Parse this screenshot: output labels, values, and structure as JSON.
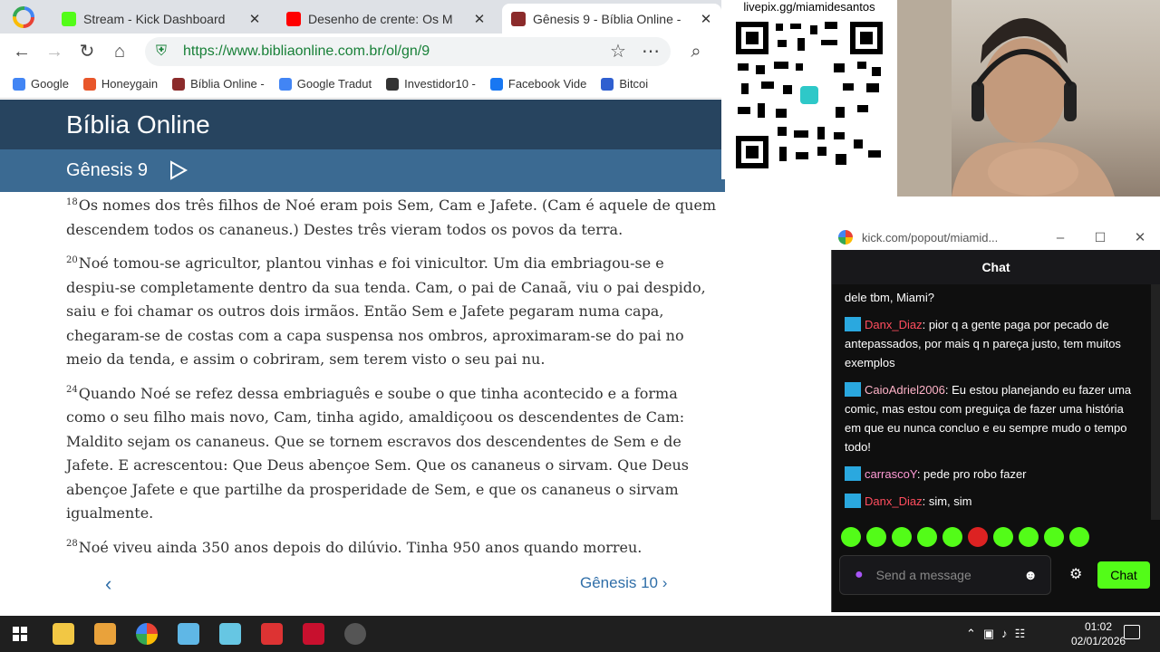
{
  "browser": {
    "tabs": [
      {
        "title": "Stream - Kick Dashboard",
        "color": "#53fc18",
        "active": false
      },
      {
        "title": "Desenho de crente: Os M",
        "color": "#ff0000",
        "active": false
      },
      {
        "title": "Gênesis 9 - Bíblia Online -",
        "color": "#8b2b2b",
        "active": true
      }
    ],
    "url": "https://www.bibliaonline.com.br/ol/gn/9",
    "bookmarks": [
      {
        "label": "Google",
        "color": "#4285f4"
      },
      {
        "label": "Honeygain",
        "color": "#e8562a"
      },
      {
        "label": "Bíblia Online -",
        "color": "#8b2b2b"
      },
      {
        "label": "Google Tradut",
        "color": "#4285f4"
      },
      {
        "label": "Investidor10 -",
        "color": "#333333"
      },
      {
        "label": "Facebook Vide",
        "color": "#1877f2"
      },
      {
        "label": "Bitcoi",
        "color": "#2f5fd0"
      }
    ]
  },
  "site": {
    "title": "Bíblia Online",
    "chapter": "Gênesis 9",
    "verses": [
      {
        "num": "18",
        "text": "Os nomes dos três filhos de Noé eram pois Sem, Cam e Jafete. (Cam é aquele de quem descendem todos os cananeus.) Destes três vieram todos os povos da terra."
      },
      {
        "num": "20",
        "text": "Noé tomou-se agricultor, plantou vinhas e foi vinicultor. Um dia embriagou-se e despiu-se completamente dentro da sua tenda. Cam, o pai de Canaã, viu o pai despido, saiu e foi chamar os outros dois irmãos. Então Sem e Jafete pegaram numa capa, chegaram-se de costas com a capa suspensa nos ombros, aproximaram-se do pai no meio da tenda, e assim o cobriram, sem terem visto o seu pai nu."
      },
      {
        "num": "24",
        "text": "Quando Noé se refez dessa embriaguês e soube o que tinha acontecido e a forma como o seu filho mais novo, Cam, tinha agido, amaldiçoou os descendentes de Cam: Maldito sejam os cananeus. Que se tornem escravos dos descendentes de Sem e de Jafete. E acrescentou: Que Deus abençoe Sem. Que os cananeus o sirvam. Que Deus abençoe Jafete e que partilhe da prosperidade de Sem, e que os cananeus o sirvam igualmente."
      },
      {
        "num": "28",
        "text": "Noé viveu ainda 350 anos depois do dilúvio. Tinha 950 anos quando morreu."
      }
    ],
    "next_label": "Gênesis 10"
  },
  "overlay": {
    "qr_label": "livepix.gg/miamidesantos"
  },
  "chat": {
    "window_title": "kick.com/popout/miamid...",
    "header": "Chat",
    "messages": [
      {
        "user": "",
        "user_color": "#ffffff",
        "text": "dele tbm, Miami?"
      },
      {
        "user": "Danx_Diaz",
        "user_color": "#ff4d5e",
        "text": ": pior q a gente paga por pecado de antepassados, por mais q n pareça justo, tem muitos exemplos"
      },
      {
        "user": "CaioAdriel2006",
        "user_color": "#ffb3c8",
        "text": ": Eu estou planejando eu fazer uma comic, mas estou com preguiça de fazer uma história em que eu nunca concluo e eu sempre mudo o tempo todo!"
      },
      {
        "user": "carrascoY",
        "user_color": "#ff9ad5",
        "text": ": pede pro robo fazer"
      },
      {
        "user": "Danx_Diaz",
        "user_color": "#ff4d5e",
        "text": ": sim, sim"
      }
    ],
    "input_placeholder": "Send a message",
    "send_label": "Chat"
  },
  "taskbar": {
    "time": "01:02",
    "date": "02/01/2026"
  }
}
